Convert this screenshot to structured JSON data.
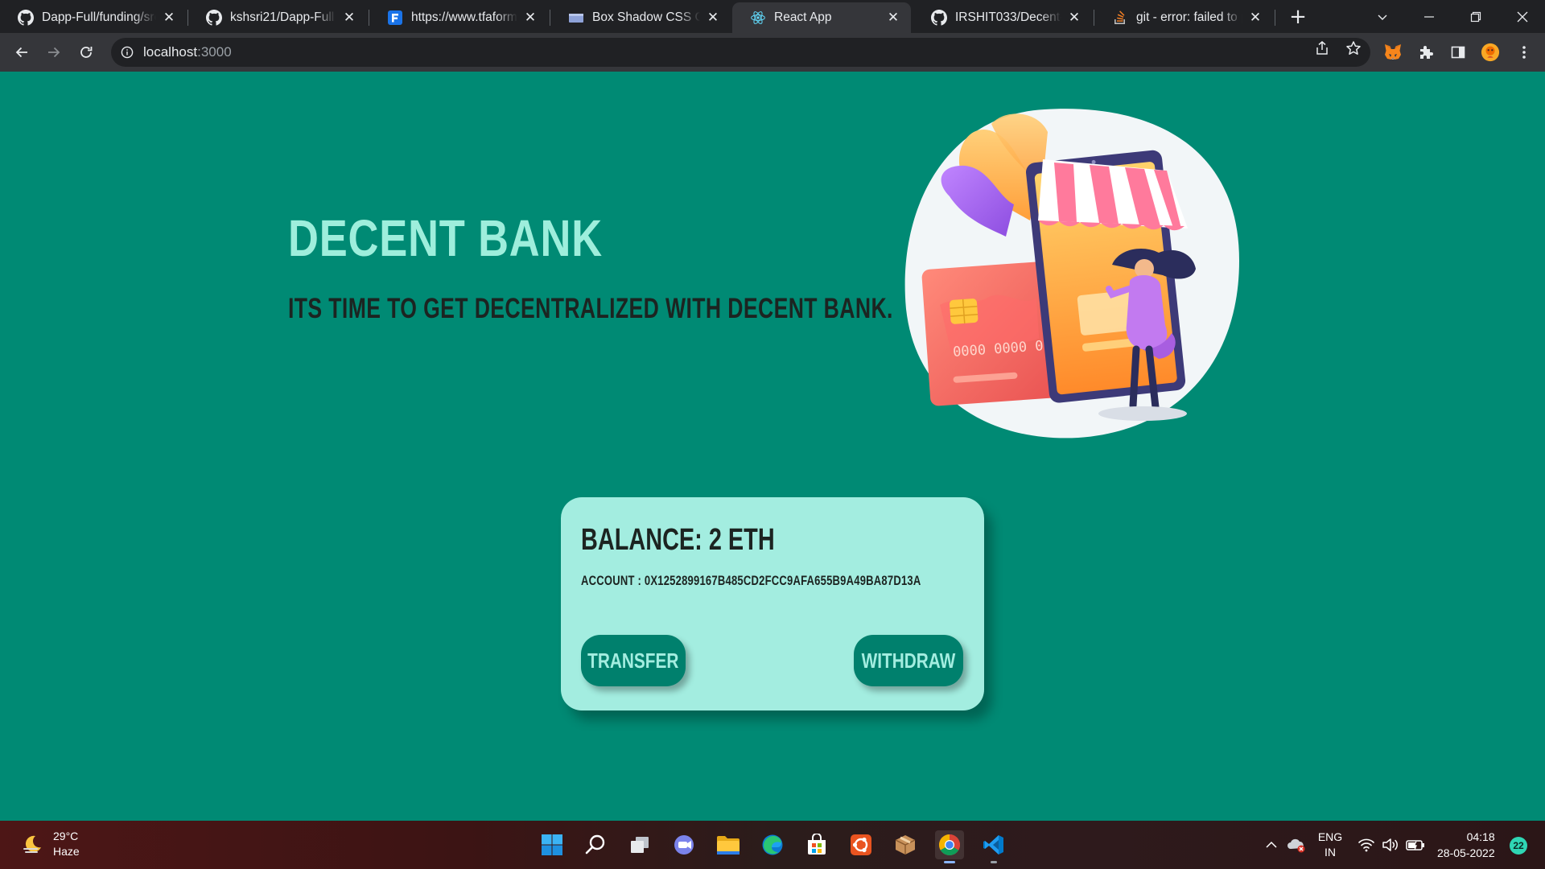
{
  "browser": {
    "tabs": [
      {
        "title": "Dapp-Full/funding/src",
        "icon": "github-icon",
        "active": false
      },
      {
        "title": "kshsri21/Dapp-Full",
        "icon": "github-icon",
        "active": false
      },
      {
        "title": "https://www.tfaforms.",
        "icon": "formassembly-icon",
        "active": false
      },
      {
        "title": "Box Shadow CSS Gen",
        "icon": "page-icon",
        "active": false
      },
      {
        "title": "React App",
        "icon": "react-icon",
        "active": true
      },
      {
        "title": "IRSHIT033/Decent-Ba",
        "icon": "github-icon",
        "active": false
      },
      {
        "title": "git - error: failed to pu",
        "icon": "stackoverflow-icon",
        "active": false
      }
    ],
    "address": {
      "host": "localhost",
      "port": ":3000"
    }
  },
  "app": {
    "title": "DECENT BANK",
    "tagline": "ITS TIME TO GET DECENTRALIZED WITH DECENT BANK.",
    "card": {
      "balance": "BALANCE: 2 ETH",
      "account": "ACCOUNT : 0X1252899167B485CD2FCC9AFA655B9A49BA87D13A",
      "transfer_label": "TRANSFER",
      "withdraw_label": "WITHDRAW"
    },
    "hero_card_number": "0000 0000 0"
  },
  "taskbar": {
    "weather": {
      "temp": "29°C",
      "condition": "Haze"
    },
    "language": {
      "lang": "ENG",
      "region": "IN"
    },
    "clock": {
      "time": "04:18",
      "date": "28-05-2022"
    },
    "notifications": "22"
  },
  "colors": {
    "page_bg": "#008a74",
    "headline": "#9eeedc",
    "card_bg": "#a3ede0",
    "button_bg": "#00806d",
    "text_dark": "#1c2421"
  }
}
